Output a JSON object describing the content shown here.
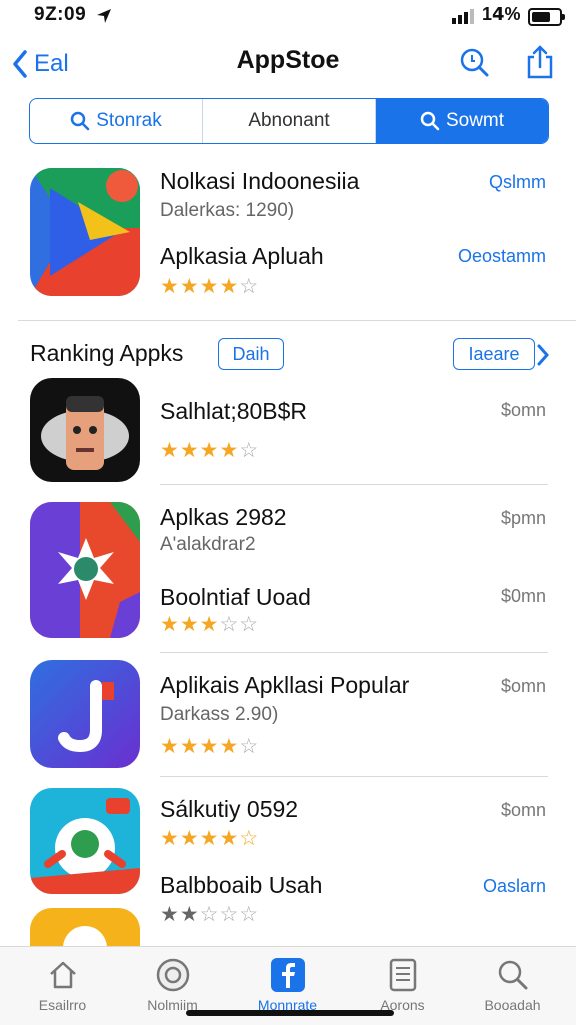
{
  "status_bar": {
    "time": "9Z:09",
    "battery": "1𝟰%"
  },
  "nav": {
    "back_label": "Eal",
    "title": "AppStoe"
  },
  "segments": [
    {
      "label": "Stonrak"
    },
    {
      "label": "Abnonant"
    },
    {
      "label": "Sowmt"
    }
  ],
  "featured": [
    {
      "title": "Nolkasi Indoonesiia",
      "subtitle": "Dalerkas: 1290)",
      "price": "Qslmm"
    },
    {
      "title": "Aplkasia Apluah",
      "price": "Oeostamm",
      "rating": 4
    }
  ],
  "ranking": {
    "title": "Ranking Appks",
    "tag": "Daih",
    "more": "Iaeare"
  },
  "apps": [
    {
      "title": "Salhlat;80B$R",
      "price": "$omn",
      "rating": 4
    },
    {
      "title": "Aplkas 2982",
      "subtitle": "A'alakdrar2",
      "price": "$pmn"
    },
    {
      "title": "Boolntiaf Uoad",
      "price": "$0mn",
      "rating": 3
    },
    {
      "title": "Aplikais Apkllasi Popular",
      "subtitle": "Darkass 2.90)",
      "price": "$omn",
      "rating": 4
    },
    {
      "title": "Sálkutiy 0592",
      "price": "$omn",
      "rating": 4
    },
    {
      "title": "Balbboaib Usah",
      "price": "Oaslarn",
      "rating": 2
    }
  ],
  "tabs": [
    {
      "label": "Esailrro",
      "icon": "home-icon"
    },
    {
      "label": "Nolmiim",
      "icon": "compass-icon"
    },
    {
      "label": "Monnrate",
      "icon": "facebook-icon"
    },
    {
      "label": "Aorons",
      "icon": "document-icon"
    },
    {
      "label": "Booadah",
      "icon": "search-icon"
    }
  ],
  "colors": {
    "accent": "#1a73e8",
    "star": "#f5a623"
  }
}
